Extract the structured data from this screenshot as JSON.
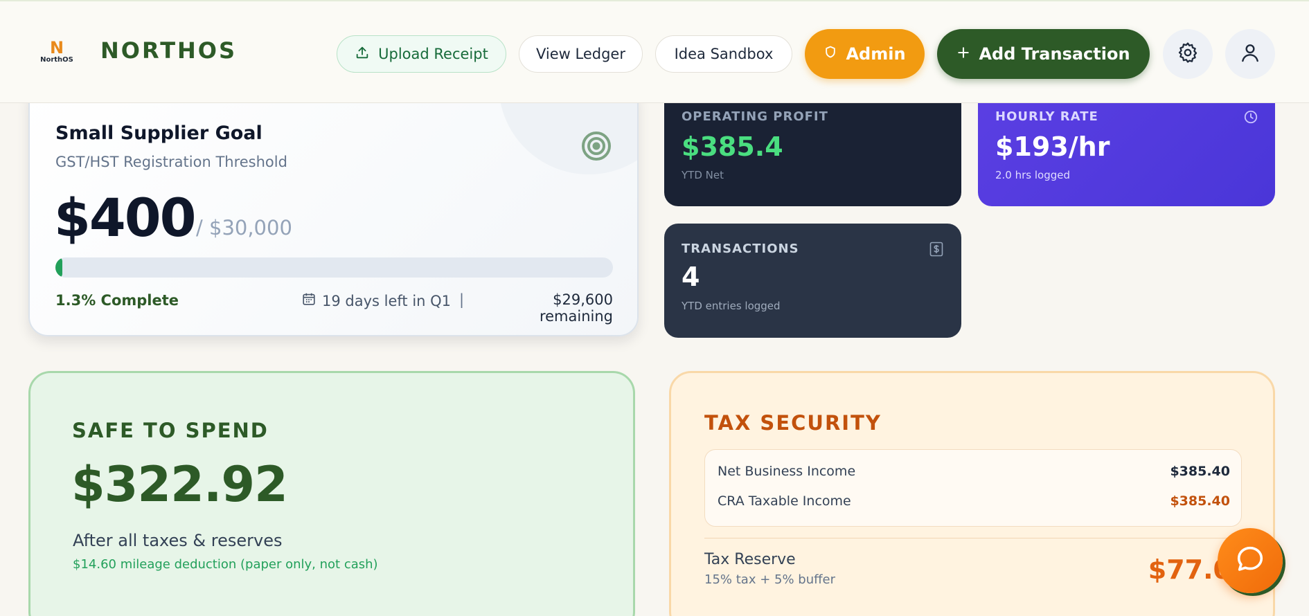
{
  "header": {
    "logo_glyph": "N",
    "logo_small": "NorthOS",
    "brand": "NORTHOS",
    "upload_label": "Upload Receipt",
    "ledger_label": "View Ledger",
    "sandbox_label": "Idea Sandbox",
    "admin_label": "Admin",
    "add_label": "Add Transaction",
    "icons": [
      "upload-icon",
      "shield-icon",
      "plus-icon",
      "gear-icon",
      "user-icon"
    ]
  },
  "goal": {
    "title": "Small Supplier Goal",
    "subtitle": "GST/HST Registration Threshold",
    "amount": "$400",
    "target": "/ $30,000",
    "progress_percent": 1.3,
    "complete_label": "1.3% Complete",
    "days_left": "19 days left in Q1",
    "separator": "|",
    "remaining": "$29,600 remaining"
  },
  "metrics": {
    "profit": {
      "label": "OPERATING PROFIT",
      "value": "$385.4",
      "note": "YTD Net"
    },
    "rate": {
      "label": "HOURLY RATE",
      "value": "$193/hr",
      "note": "2.0 hrs logged"
    },
    "transactions": {
      "label": "TRANSACTIONS",
      "value": "4",
      "note": "YTD entries logged"
    }
  },
  "safe": {
    "label": "SAFE TO SPEND",
    "amount": "$322.92",
    "after": "After all taxes & reserves",
    "mileage": "$14.60 mileage deduction (paper only, not cash)"
  },
  "tax": {
    "label": "TAX SECURITY",
    "rows": [
      {
        "label": "Net Business Income",
        "value": "$385.40"
      },
      {
        "label": "CRA Taxable Income",
        "value": "$385.40"
      }
    ],
    "reserve_label": "Tax Reserve",
    "reserve_sub": "15% tax + 5% buffer",
    "reserve_amount": "$77.0"
  },
  "colors": {
    "brand_green": "#2d5a27",
    "admin_orange": "#f29b11",
    "profit_green": "#4ade80",
    "rate_purple": "#5b3fe3",
    "tax_orange": "#c2510c"
  }
}
